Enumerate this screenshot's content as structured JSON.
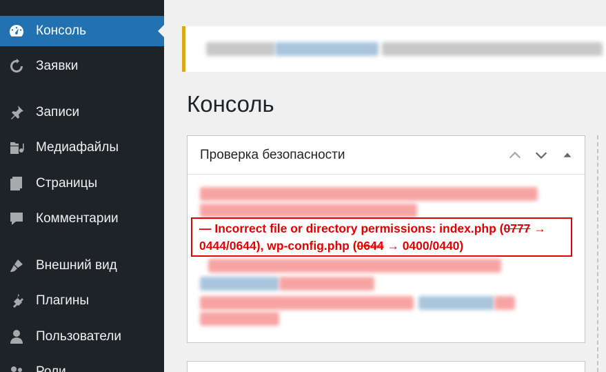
{
  "sidebar": {
    "items": [
      {
        "label": "Консоль",
        "icon": "dashboard-icon",
        "active": true
      },
      {
        "label": "Заявки",
        "icon": "refresh-icon"
      },
      {
        "label": "Записи",
        "icon": "pin-icon"
      },
      {
        "label": "Медиафайлы",
        "icon": "media-icon"
      },
      {
        "label": "Страницы",
        "icon": "pages-icon"
      },
      {
        "label": "Комментарии",
        "icon": "comment-icon"
      },
      {
        "label": "Внешний вид",
        "icon": "brush-icon"
      },
      {
        "label": "Плагины",
        "icon": "plugin-icon"
      },
      {
        "label": "Пользователи",
        "icon": "user-icon"
      },
      {
        "label": "Роли",
        "icon": "roles-icon"
      }
    ]
  },
  "page": {
    "title": "Консоль"
  },
  "widget": {
    "title": "Проверка безопасности",
    "highlight": {
      "prefix": "— Incorrect file or directory permissions: index.php (",
      "old1": "0777",
      "mid1": " → 0444/0644), wp-config.php (",
      "old2": "0644",
      "mid2": " → 0400/0440)"
    }
  },
  "colors": {
    "accent": "#2271b1",
    "sidebar_bg": "#1d2327",
    "warning": "#dba617",
    "error": "#e00000"
  }
}
